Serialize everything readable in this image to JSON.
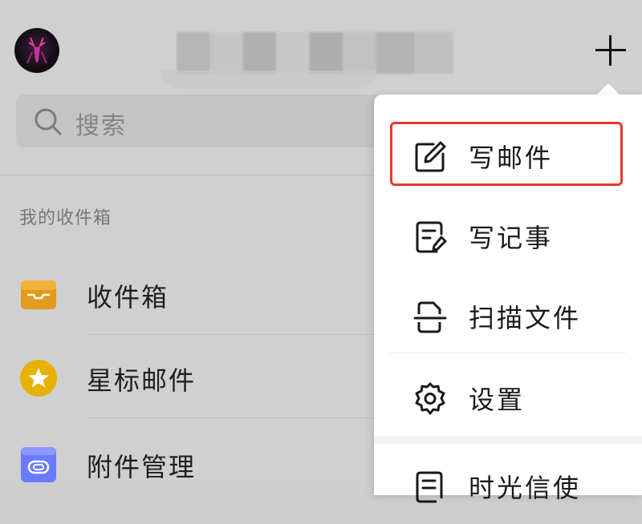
{
  "search": {
    "placeholder": "搜索"
  },
  "section": {
    "label": "我的收件箱"
  },
  "rows": [
    {
      "label": "收件箱",
      "icon": "inbox-tray-icon",
      "color": "#f0a020"
    },
    {
      "label": "星标邮件",
      "icon": "star-icon",
      "color": "#f0b400"
    },
    {
      "label": "附件管理",
      "icon": "attachment-icon",
      "color": "#6a7cff"
    }
  ],
  "menu": {
    "items": [
      {
        "label": "写邮件",
        "icon": "compose-icon"
      },
      {
        "label": "写记事",
        "icon": "note-icon"
      },
      {
        "label": "扫描文件",
        "icon": "scan-icon"
      },
      {
        "label": "设置",
        "icon": "gear-icon"
      },
      {
        "label": "时光信使",
        "icon": "document-icon"
      }
    ],
    "highlighted": "写邮件",
    "highlight_color": "#e8362c"
  }
}
